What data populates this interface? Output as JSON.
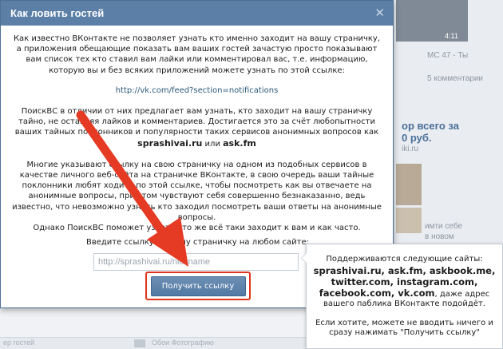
{
  "background": {
    "video_duration": "4:11",
    "side_line_1": "MC 47 - Ты",
    "side_line_2": "5 комментарии",
    "promo_line_1": "ор всего за",
    "promo_line_2": "0 руб.",
    "promo_line_3": "iki.ru",
    "side_line_3": "имти себе",
    "side_line_4": "в новом",
    "bottom_left": "ер гостей",
    "bottom_text": "Обои Фотографию"
  },
  "modal": {
    "title": "Как ловить гостей",
    "close_symbol": "✕",
    "intro": "Как известно ВКонтакте не позволяет узнать кто именно заходит на вашу страничку, а приложения обещающие показать вам ваших гостей зачастую просто показывают вам список тех кто ставил вам лайки или комментировал вас, т.е. информацию, которую вы и без всяких приложений можете узнать по этой ссылке:",
    "feed_link": "http://vk.com/feed?section=notifications",
    "p2_part1": "ПоискВС в отличии от них предлагает вам узнать, кто заходит на вашу страничку тайно, не оставляя лайков и комментариев. Достигается это за счёт любопытности ваших тайных поклонников и популярности таких сервисов анонимных вопросов как ",
    "p2_site1": "sprashivai.ru",
    "p2_or": " или ",
    "p2_site2": "ask.fm",
    "p3": "Многие указывают ссылку на свою страничку на одном из подобных сервисов в качестве личного веб-сайта на страничке ВКонтакте, в свою очередь ваши тайные поклонники любят ходить по этой ссылке, чтобы посмотреть как вы отвечаете на анонимные вопросы, при этом чувствуют себя совершенно безнаказанно, ведь известно, что невозможно узнать кто заходил посмотреть ваши ответы на анонимные вопросы.",
    "p4": "Однако ПоискВС поможет узнать кто же всё таки заходит к вам и как часто.",
    "input_label": "Введите ссылку на вашу страничку на любом сайте:",
    "input_placeholder": "http://sprashivai.ru/nickname",
    "submit_label": "Получить ссылку"
  },
  "tooltip": {
    "supported_intro": "Поддерживаются следующие сайты:",
    "sites_line1": "sprashivai.ru, ask.fm, askbook.me,",
    "sites_line2": "twitter.com, instagram.com,",
    "sites_line3": "facebook.com, vk.com",
    "tail": ", даже адрес вашего паблика ВКонтакте подойдёт.",
    "hint": "Если хотите, можете не вводить ничего и сразу нажимать \"Получить ссылку\""
  },
  "colors": {
    "header_blue": "#5b7fa6",
    "link_blue": "#2b587a",
    "highlight_red": "#e2341e",
    "arrow_red": "#e53a24"
  }
}
